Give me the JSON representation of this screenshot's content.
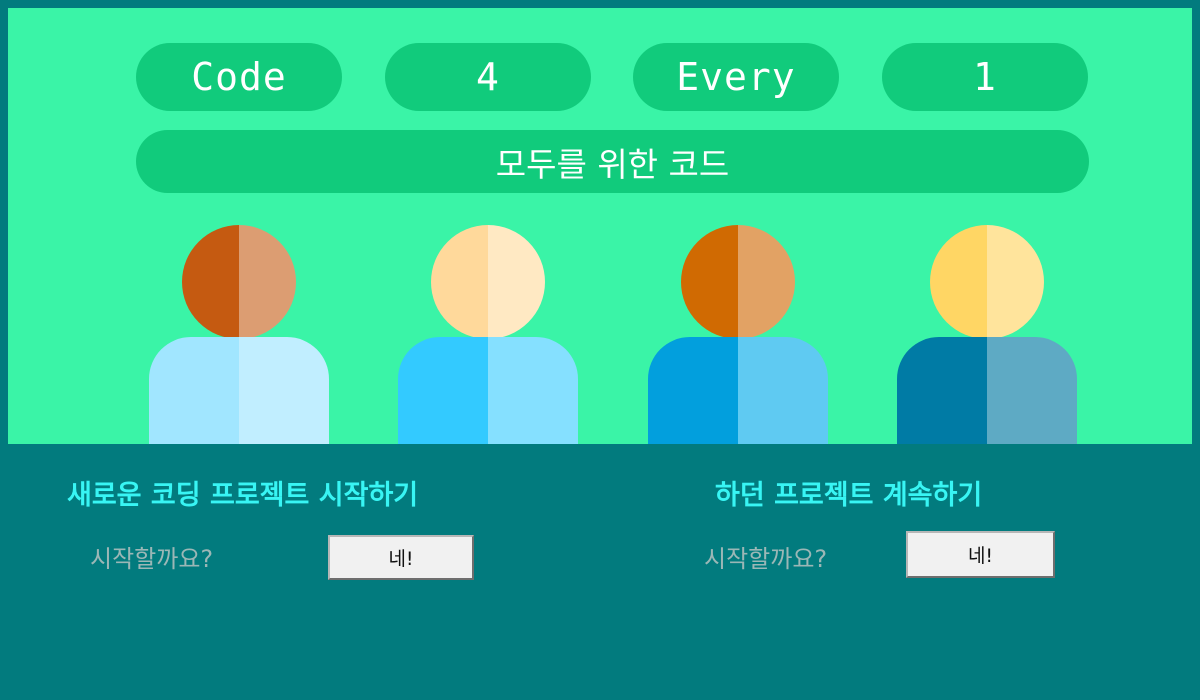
{
  "header": {
    "words": [
      "Code",
      "4",
      "Every",
      "1"
    ],
    "subtitle": "모두를 위한 코드"
  },
  "people": [
    {
      "head": [
        "#c55a11",
        "#dc9d72"
      ],
      "body": [
        "#a1e6ff",
        "#c1eeff"
      ]
    },
    {
      "head": [
        "#ffd99b",
        "#ffe9c3"
      ],
      "body": [
        "#33caff",
        "#85e0ff"
      ]
    },
    {
      "head": [
        "#d06a02",
        "#e2a264"
      ],
      "body": [
        "#029fdd",
        "#5fcaf2"
      ]
    },
    {
      "head": [
        "#ffd664",
        "#ffe49c"
      ],
      "body": [
        "#007ba5",
        "#5eaac4"
      ]
    }
  ],
  "new_project": {
    "title": "새로운 코딩 프로젝트 시작하기",
    "question": "시작할까요?",
    "button_label": "네!"
  },
  "continue_project": {
    "title": "하던 프로젝트 계속하기",
    "question": "시작할까요?",
    "button_label": "네!"
  },
  "colors": {
    "background": "#027b7e",
    "hero": "#3af4a7",
    "pill": "#11cb7c",
    "title": "#38f5f4",
    "question": "#9bb7b6"
  }
}
